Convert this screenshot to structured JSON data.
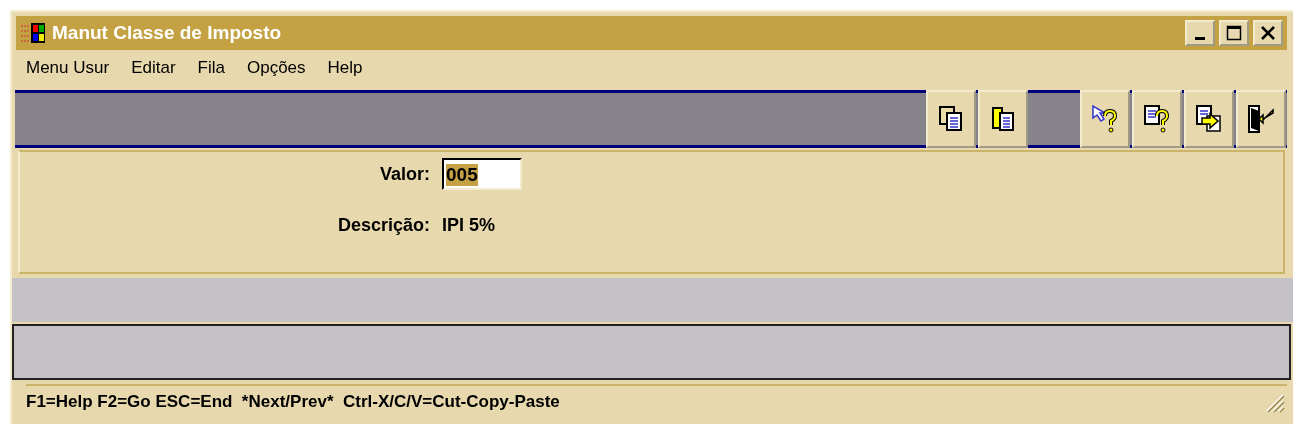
{
  "window": {
    "title": "Manut Classe de Imposto"
  },
  "menu": [
    "Menu Usur",
    "Editar",
    "Fila",
    "Opções",
    "Help"
  ],
  "toolbar": {
    "groups": [
      [
        {
          "kind": "copy"
        },
        {
          "kind": "paste"
        }
      ],
      [
        {
          "kind": "help-pointer"
        },
        {
          "kind": "help-document"
        },
        {
          "kind": "document-export"
        },
        {
          "kind": "exit"
        }
      ]
    ]
  },
  "form": {
    "valor": {
      "label": "Valor:",
      "value": "005",
      "selected": true
    },
    "descricao": {
      "label": "Descrição:",
      "value": "IPI 5%"
    }
  },
  "status_bar": "F1=Help F2=Go ESC=End  *Next/Prev*  Ctrl-X/C/V=Cut-Copy-Paste"
}
